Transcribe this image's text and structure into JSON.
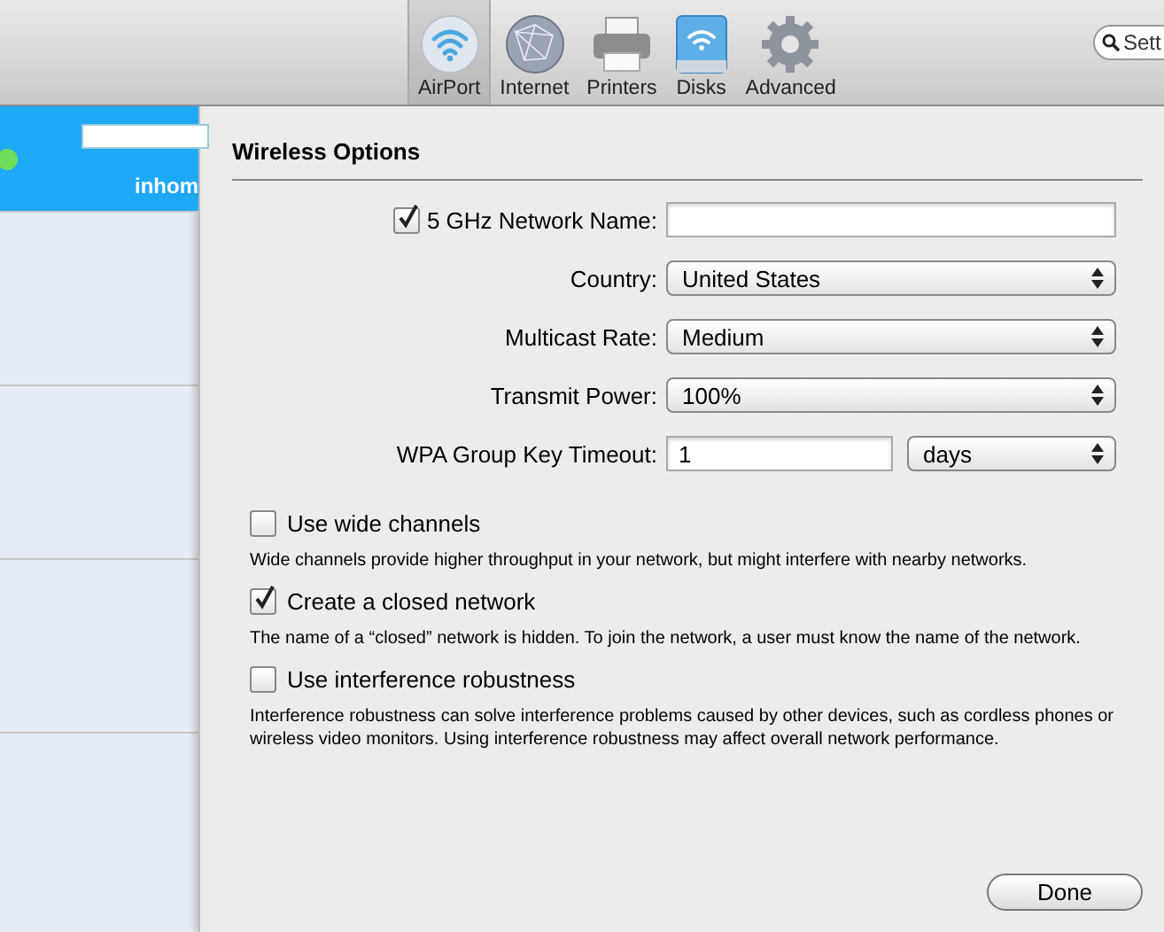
{
  "toolbar": {
    "items": [
      {
        "label": "AirPort",
        "selected": true
      },
      {
        "label": "Internet",
        "selected": false
      },
      {
        "label": "Printers",
        "selected": false
      },
      {
        "label": "Disks",
        "selected": false
      },
      {
        "label": "Advanced",
        "selected": false
      }
    ],
    "search": {
      "placeholder": "Sett"
    }
  },
  "sidebar": {
    "items": [
      {
        "name": "inhom",
        "color": "#6fdc5a",
        "selected": true
      },
      {
        "selected": false
      },
      {
        "selected": false
      },
      {
        "selected": false
      }
    ]
  },
  "sheet": {
    "title": "Wireless Options",
    "fields": [
      {
        "kind": "checked_text",
        "label": "5 GHz Network Name:",
        "checked": true
      },
      {
        "kind": "select",
        "label": "Country:",
        "value": "United States"
      },
      {
        "kind": "select",
        "label": "Multicast Rate:",
        "value": "Medium"
      },
      {
        "kind": "select",
        "label": "Transmit Power:",
        "value": "100%"
      },
      {
        "kind": "text_select",
        "label": "WPA Group Key Timeout:",
        "value": "1",
        "unit": "days"
      }
    ],
    "options": [
      {
        "label": "Use wide channels",
        "checked": false,
        "description": "Wide channels provide higher throughput in your network, but might interfere with nearby networks."
      },
      {
        "label": "Create a closed network",
        "checked": true,
        "description": "The name of a “closed” network is hidden. To join the network, a user must know the name of the network."
      },
      {
        "label": "Use interference robustness",
        "checked": false,
        "description": "Interference robustness can solve interference problems caused by other devices, such as cordless phones or wireless video monitors. Using interference robustness may affect overall network performance."
      }
    ],
    "buttons": [
      {
        "label": "Done"
      }
    ]
  }
}
